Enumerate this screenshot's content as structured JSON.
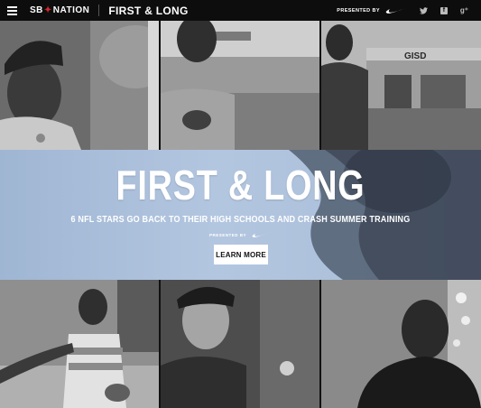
{
  "header": {
    "logo": {
      "left": "SB",
      "right": "NATION"
    },
    "section_title": "FIRST & LONG",
    "presented_by": "PRESENTED BY",
    "social": {
      "twitter": "twitter-icon",
      "facebook": "facebook-icon",
      "google": "g⁺"
    }
  },
  "hero": {
    "title": "FIRST & LONG",
    "subtitle": "6 NFL STARS GO BACK TO THEIR HIGH SCHOOLS AND CRASH SUMMER TRAINING",
    "presented_by": "PRESENTED BY",
    "cta_label": "LEARN MORE"
  },
  "tiles": {
    "middle_top_sign": "GISD"
  },
  "colors": {
    "topbar": "#0d0d0d",
    "brand_red": "#d7262c",
    "hero_blue": "#b3c6e0"
  }
}
